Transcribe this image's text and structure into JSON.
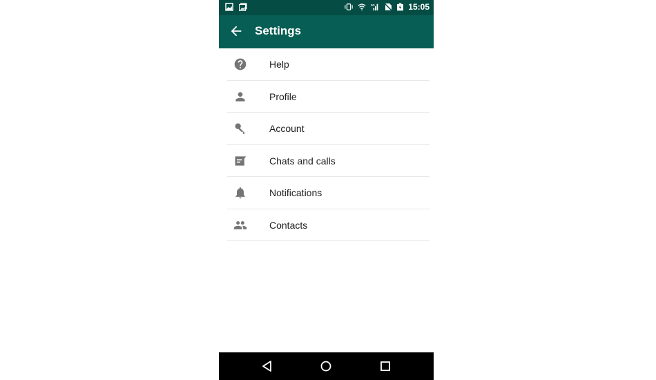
{
  "status_bar": {
    "time": "15:05",
    "left_icons": [
      "image-icon",
      "gallery-icon"
    ],
    "right_icons": [
      "vibrate-icon",
      "wifi-icon",
      "signal-3g-icon",
      "no-sim-icon",
      "battery-charging-icon"
    ]
  },
  "app_bar": {
    "title": "Settings",
    "back_icon": "arrow-back-icon"
  },
  "settings": {
    "items": [
      {
        "label": "Help",
        "icon": "help-icon"
      },
      {
        "label": "Profile",
        "icon": "person-icon"
      },
      {
        "label": "Account",
        "icon": "key-icon"
      },
      {
        "label": "Chats and calls",
        "icon": "chat-icon"
      },
      {
        "label": "Notifications",
        "icon": "bell-icon"
      },
      {
        "label": "Contacts",
        "icon": "contacts-icon"
      }
    ]
  },
  "nav_bar": {
    "buttons": [
      "back-icon",
      "home-icon",
      "recents-icon"
    ]
  },
  "colors": {
    "status_bar": "#054d44",
    "app_bar": "#075e54",
    "icon_gray": "#757575"
  }
}
